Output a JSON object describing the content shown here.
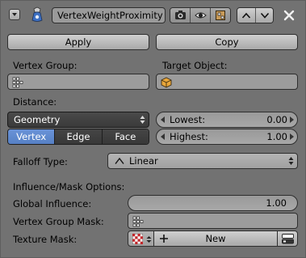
{
  "header": {
    "modifier_name": "VertexWeightProximity",
    "collapse_icon": "chevron-down-icon",
    "modifier_icon": "vertex-weight-modifier-icon",
    "visibility_icons": [
      "camera-render-icon",
      "eye-viewport-icon",
      "editmode-icon"
    ],
    "move_icons": [
      "chevron-up-icon",
      "chevron-down-icon"
    ],
    "close_icon": "close-x-icon"
  },
  "actions": {
    "apply_label": "Apply",
    "copy_label": "Copy"
  },
  "vertex_group": {
    "label": "Vertex Group:",
    "value": "",
    "icon": "vertex-group-icon"
  },
  "target_object": {
    "label": "Target Object:",
    "value": "",
    "icon": "object-cube-icon"
  },
  "distance": {
    "label": "Distance:",
    "mode": "Geometry",
    "proximity_tabs": [
      "Vertex",
      "Edge",
      "Face"
    ],
    "active_tab": "Vertex",
    "lowest_label": "Lowest:",
    "lowest_value": "0.00",
    "highest_label": "Highest:",
    "highest_value": "1.00"
  },
  "falloff": {
    "label": "Falloff Type:",
    "value": "Linear",
    "icon": "linear-falloff-icon"
  },
  "influence": {
    "section_label": "Influence/Mask Options:",
    "global_label": "Global Influence:",
    "global_value": "1.00",
    "vgroup_mask_label": "Vertex Group Mask:",
    "vgroup_mask_value": "",
    "texture_mask_label": "Texture Mask:",
    "texture_new_label": "New",
    "texture_icon": "checker-texture-icon",
    "new_icon": "plus-icon",
    "browse_icon": "browse-datablock-icon"
  },
  "colors": {
    "panel_bg": "#727272",
    "active_tab": "#5f8ad0",
    "dark_widget": "#404040"
  }
}
